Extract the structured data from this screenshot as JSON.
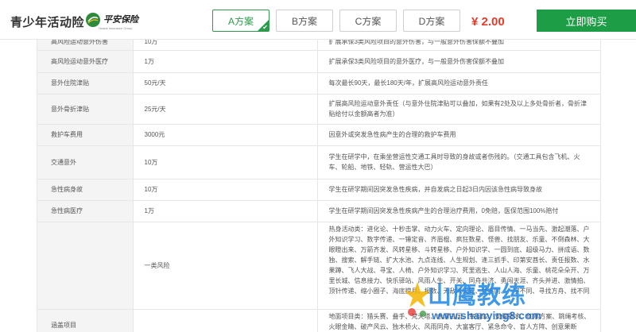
{
  "header": {
    "product_title": "青少年活动险",
    "brand_name": "平安保险",
    "brand_sub": "Huatai Insurance Group",
    "plans": [
      {
        "label": "A方案",
        "active": true
      },
      {
        "label": "B方案",
        "active": false
      },
      {
        "label": "C方案",
        "active": false
      },
      {
        "label": "D方案",
        "active": false
      }
    ],
    "price": "¥ 2.00",
    "buy_label": "立即购买"
  },
  "table": {
    "rows": [
      {
        "name": "高风险运动意外伤害",
        "amount": "10万",
        "desc": "扩展承保3类风险项目的意外伤害，与一般意外伤害保额不叠加"
      },
      {
        "name": "高风险运动意外医疗",
        "amount": "1万",
        "desc": "扩展承保3类风险项目的意外医疗，与一般意外伤害保额不叠加"
      },
      {
        "name": "意外住院津贴",
        "amount": "50元/天",
        "desc": "每次最长90天，最长180天/年，扩展高风险运动意外责任"
      },
      {
        "name": "意外骨折津贴",
        "amount": "25元/天",
        "desc": "扩展高风险运动意外责任（与意外住院津贴可以叠加，如果有2处及以上多处骨折者，骨折津贴给付以金额高者为准）"
      },
      {
        "name": "救护车费用",
        "amount": "3000元",
        "desc": "因意外或突发急性病产生的合理的救护车费用"
      },
      {
        "name": "交通意外",
        "amount": "10万",
        "desc": "学生在研学中，在乘坐营运性交通工具时导致的身故或者伤残的。（交通工具包含飞机、火车、轮船、地铁、轻轨、营运性大巴）"
      },
      {
        "name": "急性病身故",
        "amount": "10万",
        "desc": "学生在研学期间因突发急性疾病，并自发病之日起3日内因该急性病导致身故"
      },
      {
        "name": "急性病医疗",
        "amount": "1万",
        "desc": "学生在研学期间因突发急性疾病产生的合理治疗费用，0免赔，医保范围100%赔付"
      },
      {
        "name": "",
        "amount": "一类风险",
        "desc": "热身活动类：进化论、十秒击掌、动力火车、定向理论、眉目传情、一马当先、激起潮落、户外知识学习、数字传递、一锤定音、齐眉棍、疯狂数星、怪兽、找朋友、乐童、不倒森林、大眼瞪出来、万箭齐发、风转星移、斗转星移、户外知识学、一圆到底、超级马力、拼成语、数独、搜索、解手链、扩大水池、九点连线、人生规划、逢三抓手、印第安酋长、责任报数、水果蹲、飞人大战、寻宝、人椅、户外知识学习、死里逃生、人山人海、乐童、桃花朵朵开、万里长城、信息接力、快乐驿站、风雨人生、开关、同舟共济、勇闯天涯、齐头并进、激情拍、顶针传递、缩小圈子、海底捞月、报数、无敌风火轮、找不同、一字不同、寻找方舟、找不同"
      },
      {
        "name": "涵盖项目",
        "amount": "",
        "desc": "地面项目类：猎头赛、叠手、梵天塔、水漂三国、幸运52、安保技术、红黑方案、跳绳考核、火眼金睛、破产风云、独木桥火、风雨同舟、大富客厅、紧急命令、盲人方阵、创意果断"
      }
    ]
  },
  "watermark": {
    "main": "山鹰教练",
    "url": "www.shanying8.com"
  }
}
